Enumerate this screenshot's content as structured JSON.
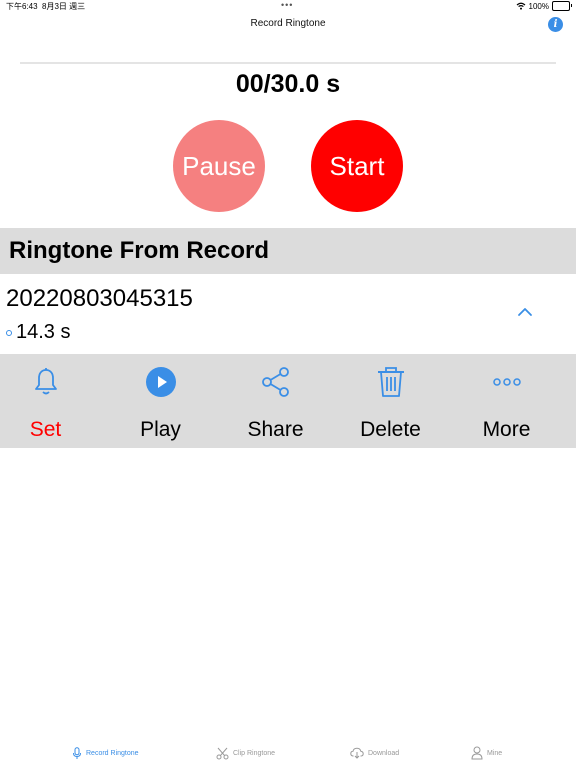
{
  "status_bar": {
    "time": "下午6:43",
    "date": "8月3日 週三",
    "battery": "100%",
    "battery_level": 1.0
  },
  "nav": {
    "title": "Record Ringtone",
    "info_icon": "info-icon"
  },
  "recorder": {
    "timer": "00/30.0 s",
    "progress": 0,
    "pause_label": "Pause",
    "start_label": "Start"
  },
  "section": {
    "title": "Ringtone From Record"
  },
  "record": {
    "name": "20220803045315",
    "duration": "14.3 s"
  },
  "actions": [
    {
      "label": "Set",
      "icon": "bell-icon"
    },
    {
      "label": "Play",
      "icon": "play-icon"
    },
    {
      "label": "Share",
      "icon": "share-icon"
    },
    {
      "label": "Delete",
      "icon": "trash-icon"
    },
    {
      "label": "More",
      "icon": "more-icon"
    }
  ],
  "tabs": [
    {
      "label": "Record Ringtone",
      "icon": "microphone-icon",
      "active": true
    },
    {
      "label": "Clip Ringtone",
      "icon": "scissors-icon",
      "active": false
    },
    {
      "label": "Download",
      "icon": "cloud-download-icon",
      "active": false
    },
    {
      "label": "Mine",
      "icon": "person-icon",
      "active": false
    }
  ],
  "colors": {
    "accent": "#3a8ee6",
    "start": "#ff0000",
    "pause": "#f58080",
    "set_label": "#ff0000",
    "section_bg": "#dcdcdc"
  }
}
